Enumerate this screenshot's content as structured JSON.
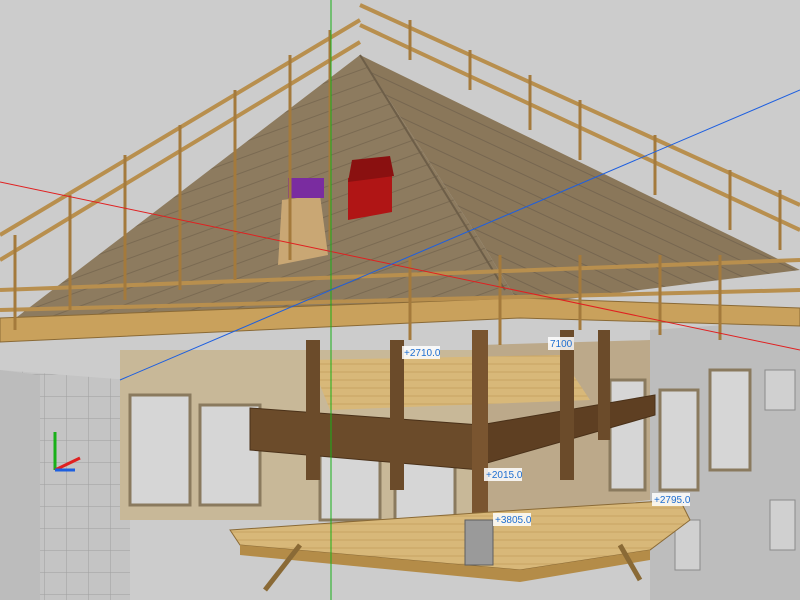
{
  "app": {
    "view": "3d-model-viewport"
  },
  "colors": {
    "background": "#c9c9c9",
    "roof_surface": "#8a7a62",
    "timber": "#c9a15c",
    "dark_beam": "#6b4b2a",
    "plaster_wall": "#c8b898",
    "facade_gray": "#b9b9b9",
    "axis_x": "#e02020",
    "axis_y": "#18b018",
    "axis_z": "#1d5fe0",
    "chimney_red": "#b01515",
    "chimney_purple": "#7a2ca0"
  },
  "dimensions": {
    "d1": "+2710.0",
    "d2": "7100",
    "d3": "+2795.0",
    "d4": "+3805.0",
    "d5": "+2015.0"
  },
  "gizmo": {
    "x_label": "",
    "y_label": "",
    "z_label": ""
  }
}
